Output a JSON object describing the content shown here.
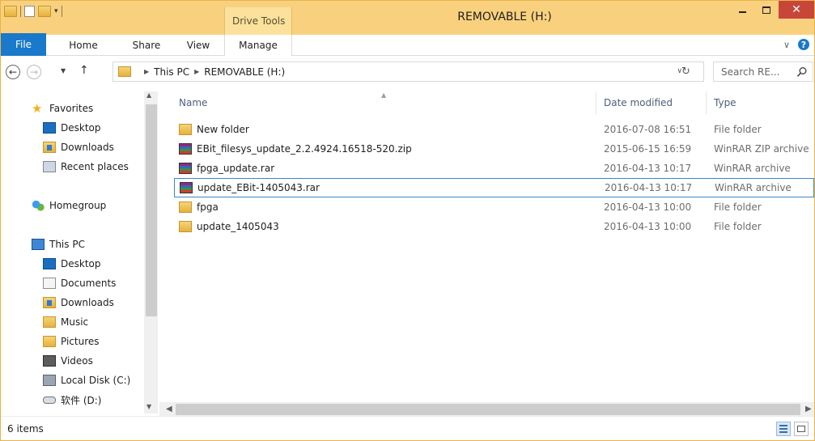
{
  "window": {
    "title": "REMOVABLE (H:)",
    "context_tab": "Drive Tools",
    "close_glyph": "✕"
  },
  "ribbon": {
    "tabs": [
      "File",
      "Home",
      "Share",
      "View",
      "Manage"
    ]
  },
  "address": {
    "crumbs": [
      "This PC",
      "REMOVABLE (H:)"
    ],
    "search_placeholder": "Search RE..."
  },
  "nav": {
    "favorites_label": "Favorites",
    "favorites": [
      "Desktop",
      "Downloads",
      "Recent places"
    ],
    "homegroup": "Homegroup",
    "thispc_label": "This PC",
    "thispc": [
      "Desktop",
      "Documents",
      "Downloads",
      "Music",
      "Pictures",
      "Videos",
      "Local Disk (C:)",
      "软件 (D:)"
    ]
  },
  "columns": {
    "name": "Name",
    "date": "Date modified",
    "type": "Type"
  },
  "files": [
    {
      "name": "New folder",
      "date": "2016-07-08 16:51",
      "type": "File folder",
      "icon": "folder-icon"
    },
    {
      "name": "EBit_filesys_update_2.2.4924.16518-520.zip",
      "date": "2015-06-15 16:59",
      "type": "WinRAR ZIP archive",
      "icon": "winrar-icon"
    },
    {
      "name": "fpga_update.rar",
      "date": "2016-04-13 10:17",
      "type": "WinRAR archive",
      "icon": "winrar-icon"
    },
    {
      "name": "update_EBit-1405043.rar",
      "date": "2016-04-13 10:17",
      "type": "WinRAR archive",
      "icon": "winrar-icon"
    },
    {
      "name": "fpga",
      "date": "2016-04-13 10:00",
      "type": "File folder",
      "icon": "folder-icon"
    },
    {
      "name": "update_1405043",
      "date": "2016-04-13 10:00",
      "type": "File folder",
      "icon": "folder-icon"
    }
  ],
  "status": {
    "item_count": "6 items"
  }
}
